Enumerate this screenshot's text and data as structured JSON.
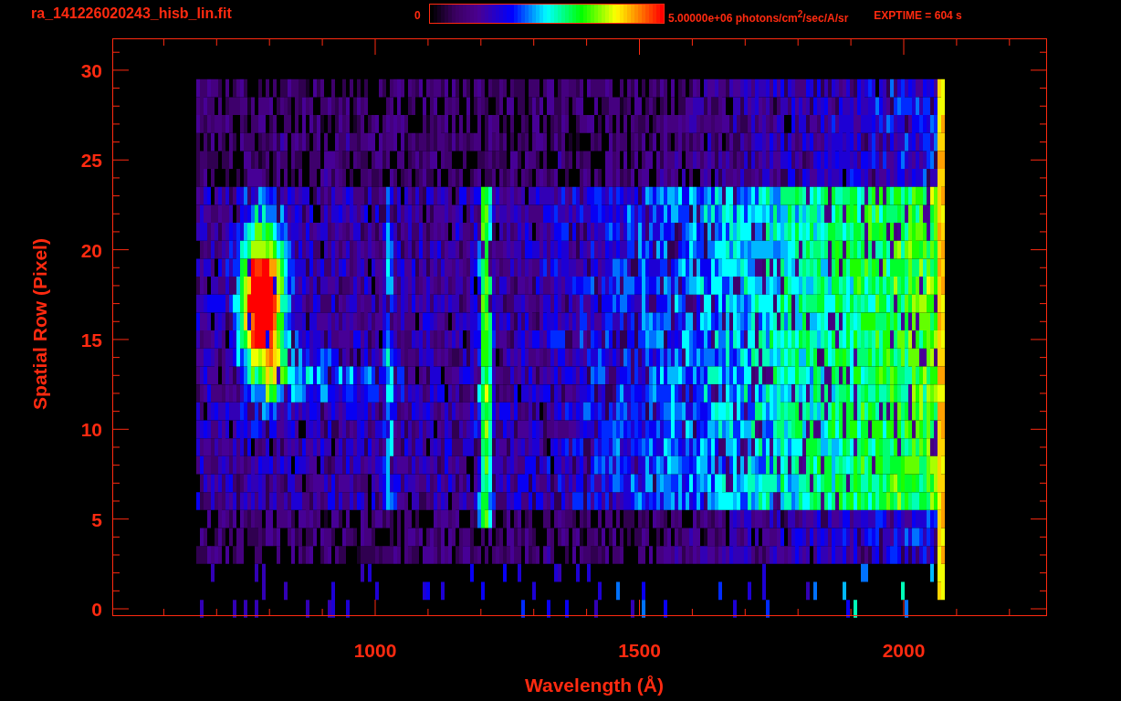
{
  "title": "ra_141226020243_hisb_lin.fit",
  "colorbar": {
    "min_label": "0",
    "max_label": "5.00000e+06 photons/cm$^{2}$/sec/A/sr"
  },
  "exposure": "EXPTIME = 604 s",
  "plot": {
    "ylabel": "Spatial Row (Pixel)",
    "xlabel": "Wavelength (Å)",
    "yticks": [
      "30",
      "25",
      "20",
      "15",
      "10",
      "5",
      "0"
    ],
    "xticks": [
      "1000",
      "1500",
      "2000"
    ]
  }
}
